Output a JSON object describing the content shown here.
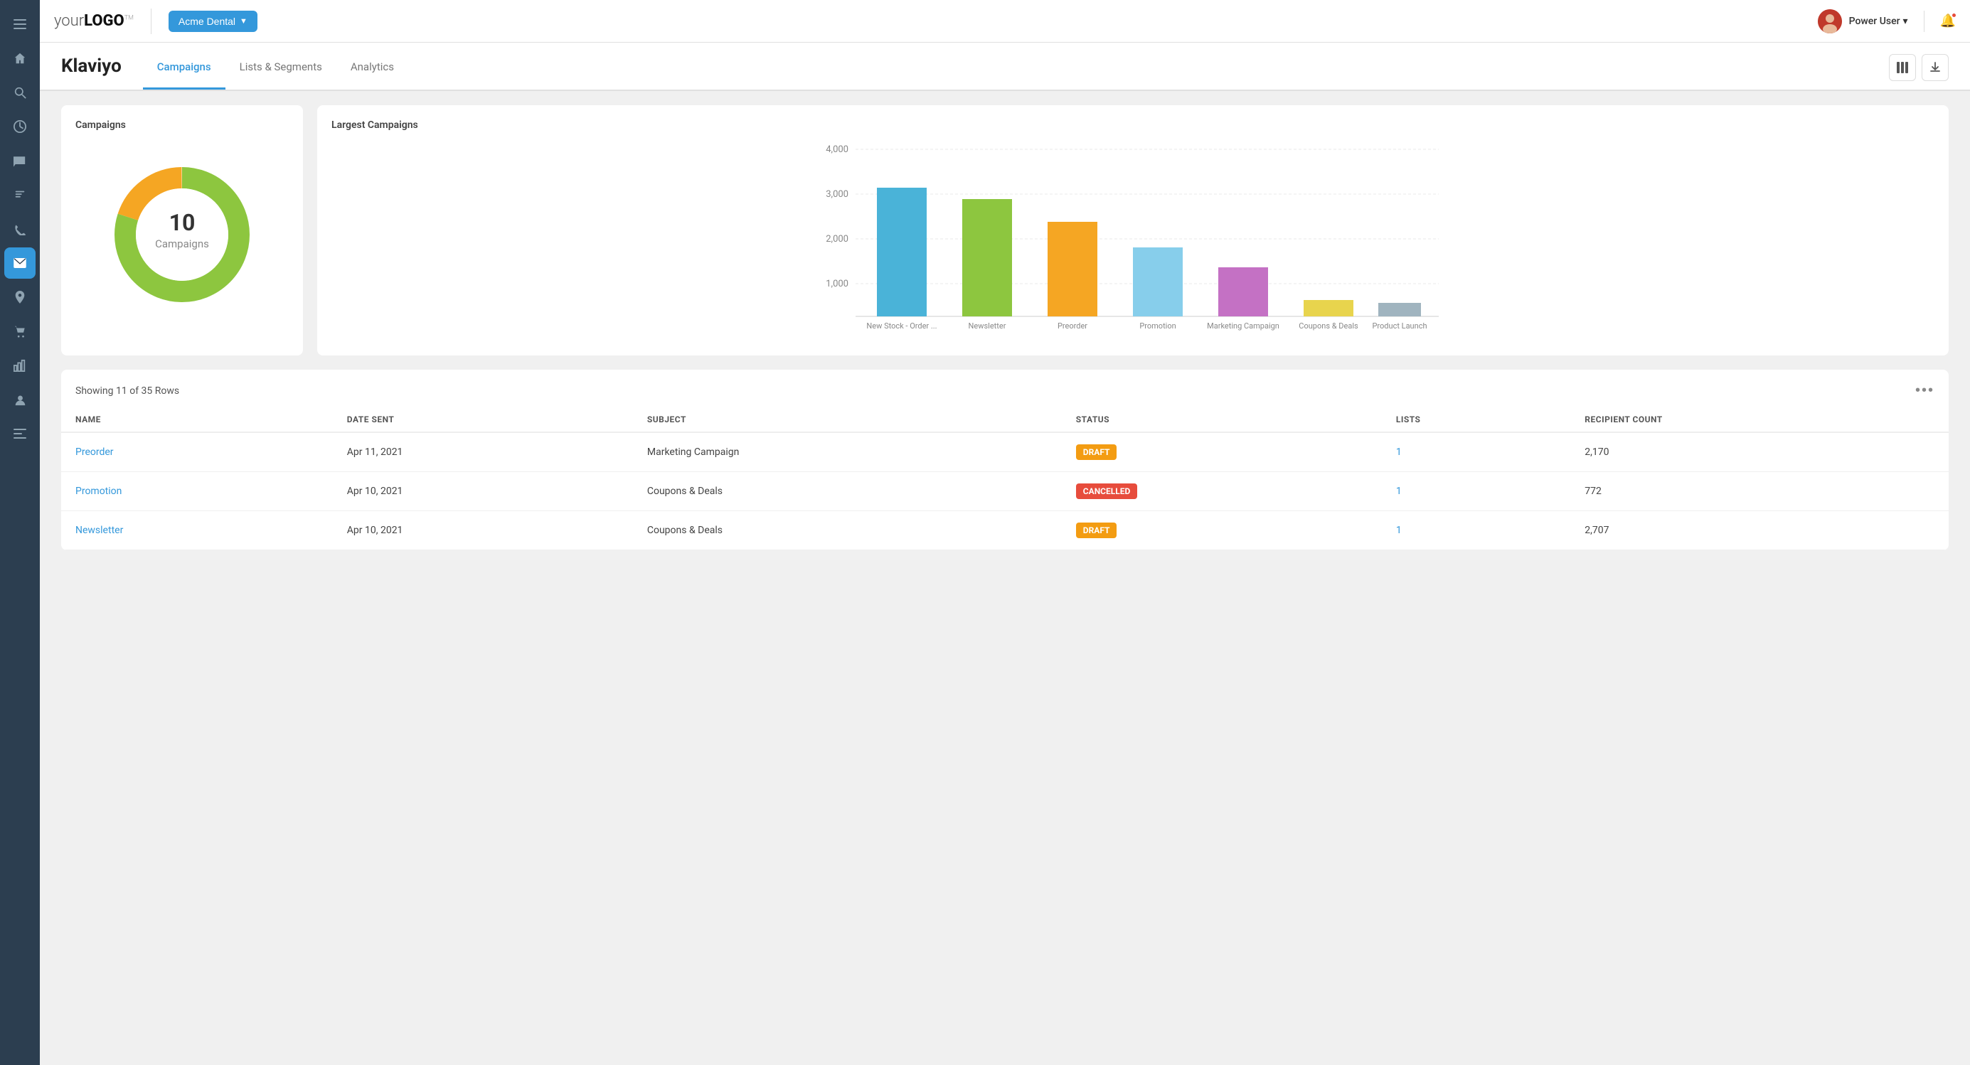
{
  "logo": {
    "text": "your",
    "bold": "LOGO",
    "sup": "TM"
  },
  "tenant": {
    "name": "Acme Dental",
    "chevron": "▼"
  },
  "user": {
    "name": "Power User",
    "chevron": "▾"
  },
  "topbar": {
    "icon_columns": "⊞",
    "icon_download": "⬇"
  },
  "page": {
    "title": "Klaviyo"
  },
  "tabs": [
    {
      "label": "Campaigns",
      "active": true
    },
    {
      "label": "Lists & Segments",
      "active": false
    },
    {
      "label": "Analytics",
      "active": false
    }
  ],
  "donut_chart": {
    "title": "Campaigns",
    "center_number": "10",
    "center_label": "Campaigns",
    "segments": [
      {
        "color": "#8dc63f",
        "value": 80
      },
      {
        "color": "#f5a623",
        "value": 20
      }
    ]
  },
  "bar_chart": {
    "title": "Largest Campaigns",
    "y_labels": [
      "4,000",
      "3,000",
      "2,000",
      "1,000"
    ],
    "bars": [
      {
        "label": "New Stock - Order ...",
        "value": 2900,
        "color": "#4ab3d8"
      },
      {
        "label": "Newsletter",
        "value": 2600,
        "color": "#8dc63f"
      },
      {
        "label": "Preorder",
        "value": 2050,
        "color": "#f5a623"
      },
      {
        "label": "Promotion",
        "value": 1550,
        "color": "#87ceeb"
      },
      {
        "label": "Marketing Campaign",
        "value": 1100,
        "color": "#c471c4"
      },
      {
        "label": "Coupons & Deals",
        "value": 380,
        "color": "#e8d44d"
      },
      {
        "label": "Product Launch",
        "value": 320,
        "color": "#a0b4bf"
      }
    ],
    "max_value": 4000
  },
  "table": {
    "showing": "Showing 11 of 35 Rows",
    "columns": [
      "NAME",
      "DATE SENT",
      "SUBJECT",
      "STATUS",
      "LISTS",
      "RECIPIENT COUNT"
    ],
    "rows": [
      {
        "name": "Preorder",
        "date": "Apr 11, 2021",
        "subject": "Marketing Campaign",
        "status": "DRAFT",
        "status_type": "draft",
        "lists": "1",
        "count": "2,170"
      },
      {
        "name": "Promotion",
        "date": "Apr 10, 2021",
        "subject": "Coupons & Deals",
        "status": "CANCELLED",
        "status_type": "cancelled",
        "lists": "1",
        "count": "772"
      },
      {
        "name": "Newsletter",
        "date": "Apr 10, 2021",
        "subject": "Coupons & Deals",
        "status": "DRAFT",
        "status_type": "draft",
        "lists": "1",
        "count": "2,707"
      }
    ]
  },
  "sidebar_icons": [
    "☰",
    "🔍",
    "⏱",
    "💬",
    "📣",
    "📞",
    "✉",
    "📍",
    "🛒",
    "📊",
    "👤",
    "≡"
  ],
  "sidebar_active_index": 6
}
